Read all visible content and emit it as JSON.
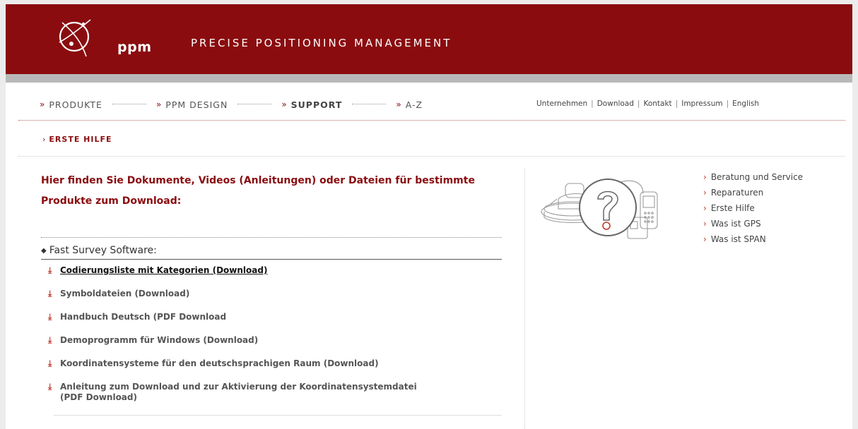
{
  "header": {
    "brand": "ppm",
    "tagline": "PRECISE POSITIONING MANAGEMENT",
    "bg_color": "#8a0c0f"
  },
  "main_nav": [
    {
      "label": "PRODUKTE",
      "active": false
    },
    {
      "label": "PPM DESIGN",
      "active": false
    },
    {
      "label": "SUPPORT",
      "active": true
    },
    {
      "label": "A-Z",
      "active": false
    }
  ],
  "top_links": [
    "Unternehmen",
    "Download",
    "Kontakt",
    "Impressum",
    "English"
  ],
  "subnav": {
    "label": "ERSTE HILFE"
  },
  "intro": "Hier finden Sie Dokumente, Videos (Anleitungen) oder Dateien für bestimmte Produkte zum Download:",
  "section": {
    "title": "Fast Survey Software:",
    "downloads": [
      {
        "line1": "Codierungsliste mit Kategorien (Download)",
        "line2": ""
      },
      {
        "line1": "Symboldateien (Download)",
        "line2": ""
      },
      {
        "line1": "Handbuch Deutsch (PDF Download",
        "line2": ""
      },
      {
        "line1": "Demoprogramm für Windows (Download)",
        "line2": ""
      },
      {
        "line1": "Koordinatensysteme für den deutschsprachigen Raum (Download)",
        "line2": ""
      },
      {
        "line1": "Anleitung zum Download und zur Aktivierung der Koordinatensystemdatei",
        "line2": "(PDF Download)"
      }
    ]
  },
  "side_links": [
    "Beratung und Service",
    "Reparaturen",
    "Erste Hilfe",
    "Was ist GPS",
    "Was ist SPAN"
  ],
  "icons": {
    "nav_arrow": "»",
    "chevron": "›",
    "download": "⤓",
    "bullet": "◆"
  }
}
